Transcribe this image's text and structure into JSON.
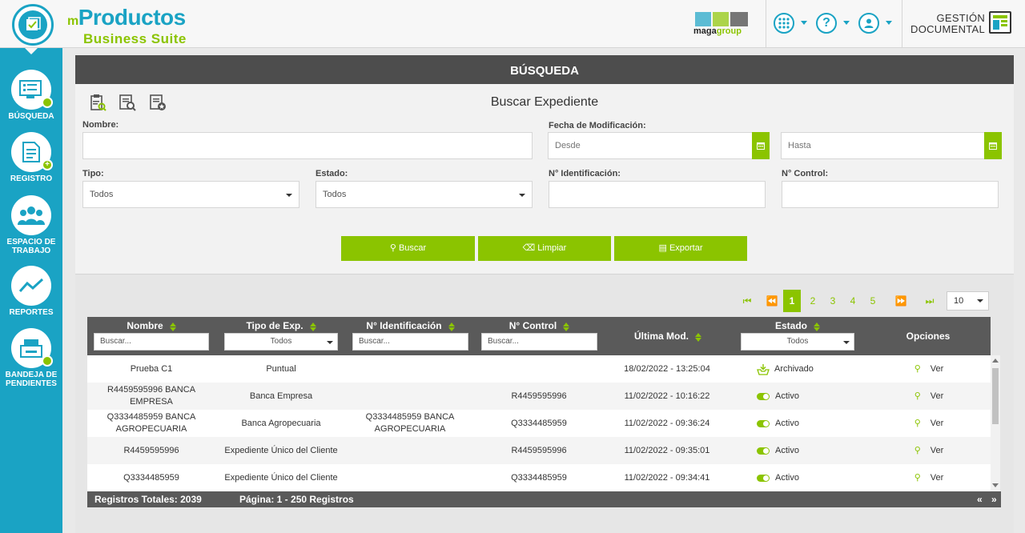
{
  "brand": {
    "prefix": "m",
    "name": "Productos",
    "subtitle": "Business Suite"
  },
  "partner": {
    "word1": "maga",
    "word2": "group"
  },
  "header": {
    "help_glyph": "?",
    "module_line1": "GESTIÓN",
    "module_line2": "DOCUMENTAL"
  },
  "sidebar": {
    "items": [
      {
        "line1": "BÚSQUEDA",
        "line2": "",
        "icon": "search-doc-icon"
      },
      {
        "line1": "REGISTRO",
        "line2": "",
        "icon": "add-doc-icon"
      },
      {
        "line1": "ESPACIO DE",
        "line2": "TRABAJO",
        "icon": "users-icon"
      },
      {
        "line1": "REPORTES",
        "line2": "",
        "icon": "chart-line-icon"
      },
      {
        "line1": "BANDEJA DE",
        "line2": "PENDIENTES",
        "icon": "tray-icon"
      }
    ]
  },
  "panel": {
    "heading": "BÚSQUEDA",
    "form_title": "Buscar Expediente"
  },
  "form": {
    "nombre_label": "Nombre:",
    "fecha_label": "Fecha de Modificación:",
    "desde_placeholder": "Desde",
    "hasta_placeholder": "Hasta",
    "tipo_label": "Tipo:",
    "tipo_value": "Todos",
    "estado_label": "Estado:",
    "estado_value": "Todos",
    "ident_label": "N° Identificación:",
    "control_label": "N° Control:"
  },
  "buttons": {
    "search": "Buscar",
    "clear": "Limpiar",
    "export": "Exportar"
  },
  "pagination": {
    "pages": [
      "1",
      "2",
      "3",
      "4",
      "5"
    ],
    "current": "1",
    "per_page": "10"
  },
  "table": {
    "columns": {
      "nombre": "Nombre",
      "tipo": "Tipo de Exp.",
      "ident": "N° Identificación",
      "control": "N° Control",
      "mod": "Última Mod.",
      "estado": "Estado",
      "opciones": "Opciones"
    },
    "filter_placeholder": "Buscar...",
    "filter_all": "Todos",
    "view_label": "Ver",
    "rows": [
      {
        "nombre": "Prueba C1",
        "tipo": "Puntual",
        "ident": "",
        "control": "",
        "mod": "18/02/2022 - 13:25:04",
        "estado": "Archivado",
        "estado_kind": "archived"
      },
      {
        "nombre": "R4459595996 BANCA EMPRESA",
        "tipo": "Banca Empresa",
        "ident": "",
        "control": "R4459595996",
        "mod": "11/02/2022 - 10:16:22",
        "estado": "Activo",
        "estado_kind": "active"
      },
      {
        "nombre": "Q3334485959 BANCA AGROPECUARIA",
        "tipo": "Banca Agropecuaria",
        "ident": "Q3334485959 BANCA AGROPECUARIA",
        "control": "Q3334485959",
        "mod": "11/02/2022 - 09:36:24",
        "estado": "Activo",
        "estado_kind": "active"
      },
      {
        "nombre": "R4459595996",
        "tipo": "Expediente Único del Cliente",
        "ident": "",
        "control": "R4459595996",
        "mod": "11/02/2022 - 09:35:01",
        "estado": "Activo",
        "estado_kind": "active"
      },
      {
        "nombre": "Q3334485959",
        "tipo": "Expediente Único del Cliente",
        "ident": "",
        "control": "Q3334485959",
        "mod": "11/02/2022 - 09:34:41",
        "estado": "Activo",
        "estado_kind": "active"
      }
    ],
    "footer_total": "Registros Totales: 2039",
    "footer_page": "Página: 1 - 250 Registros",
    "footer_prev": "«",
    "footer_next": "»"
  },
  "colors": {
    "primary": "#1aa3c4",
    "accent": "#8bc400",
    "header_dark": "#4d4d4d"
  }
}
